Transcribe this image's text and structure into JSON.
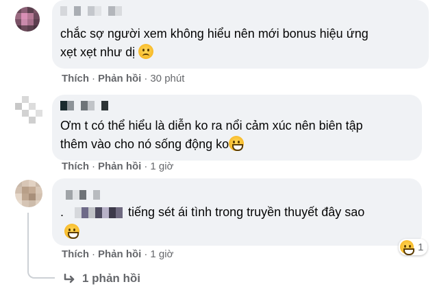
{
  "comments": [
    {
      "text": "chắc sợ người xem không hiểu nên mới bonus hiệu ứng xẹt xẹt như dị",
      "text_line1": "chắc sợ người xem không hiểu nên mới bonus hiệu ứng",
      "text_line2": "xẹt xẹt như dị",
      "emoji": "sad-tear-face-icon",
      "like_label": "Thích",
      "reply_label": "Phản hồi",
      "time": "30 phút"
    },
    {
      "text": "Ơm t có thể hiểu là diễn ko ra nổi cảm xúc nên biên tập thêm vào cho nó sống động ko",
      "text_line1": "Ơm t có thể hiểu là diễn ko ra nổi cảm xúc nên biên tập",
      "text_line2": "thêm vào cho nó sống động ko",
      "emoji": "grinning-face-icon",
      "like_label": "Thích",
      "reply_label": "Phản hồi",
      "time": "1 giờ"
    },
    {
      "text_prefix": ".",
      "text": "tiếng sét ái tình trong truyền thuyết đây sao",
      "emoji": "grimacing-face-icon",
      "like_label": "Thích",
      "reply_label": "Phản hồi",
      "time": "1 giờ",
      "reaction_count": "1",
      "reaction_icon": "haha-reaction-icon"
    }
  ],
  "view_replies_label": "1 phản hồi",
  "separator": "·",
  "colors": {
    "bubble": "#f0f2f5",
    "secondary_text": "#65676b",
    "primary_text": "#050505"
  }
}
